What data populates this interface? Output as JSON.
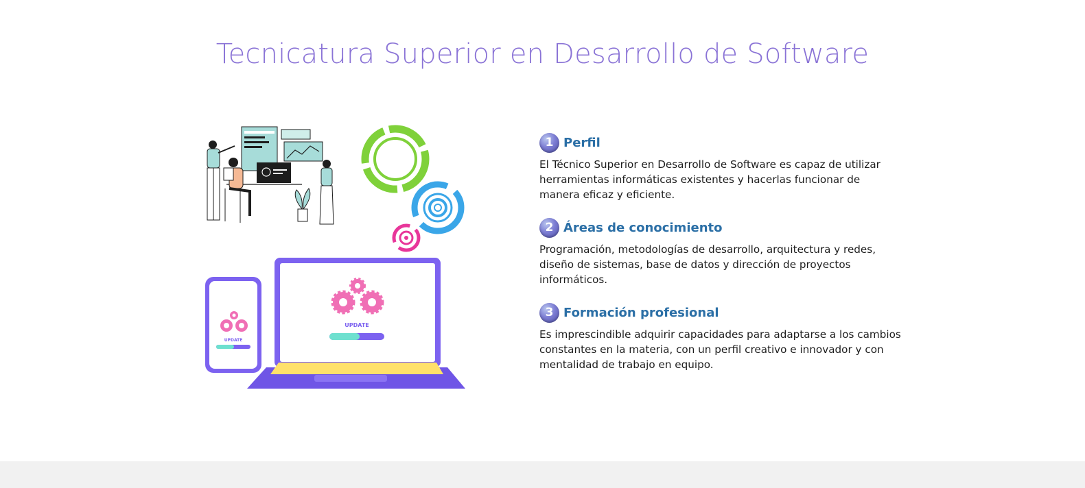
{
  "page": {
    "title": "Tecnicatura Superior en Desarrollo de Software"
  },
  "illustration": {
    "laptop_screen_label": "UPDATE",
    "phone_screen_label": "UPDATE"
  },
  "sections": [
    {
      "number": "1",
      "title": "Perfil",
      "text": "El Técnico Superior en Desarrollo de Software es capaz de utilizar herramientas informáticas existentes y hacerlas funcionar de manera eficaz y eficiente."
    },
    {
      "number": "2",
      "title": "Áreas de conocimiento",
      "text": "Programación, metodologías de desarrollo, arquitectura y redes, diseño de sistemas, base de datos y dirección de proyectos informáticos."
    },
    {
      "number": "3",
      "title": "Formación profesional",
      "text": "Es imprescindible adquirir capacidades para adaptarse a los cambios constantes en la materia, con un perfil creativo e innovador y con mentalidad de trabajo en equipo."
    }
  ],
  "colors": {
    "title": "#8a73d6",
    "heading": "#2b6fa6",
    "laptop": "#7c62f0",
    "gear": "#f06fb5",
    "ring_green": "#7fd13a",
    "ring_blue": "#3aa6e8",
    "ring_pink": "#e8369a"
  }
}
